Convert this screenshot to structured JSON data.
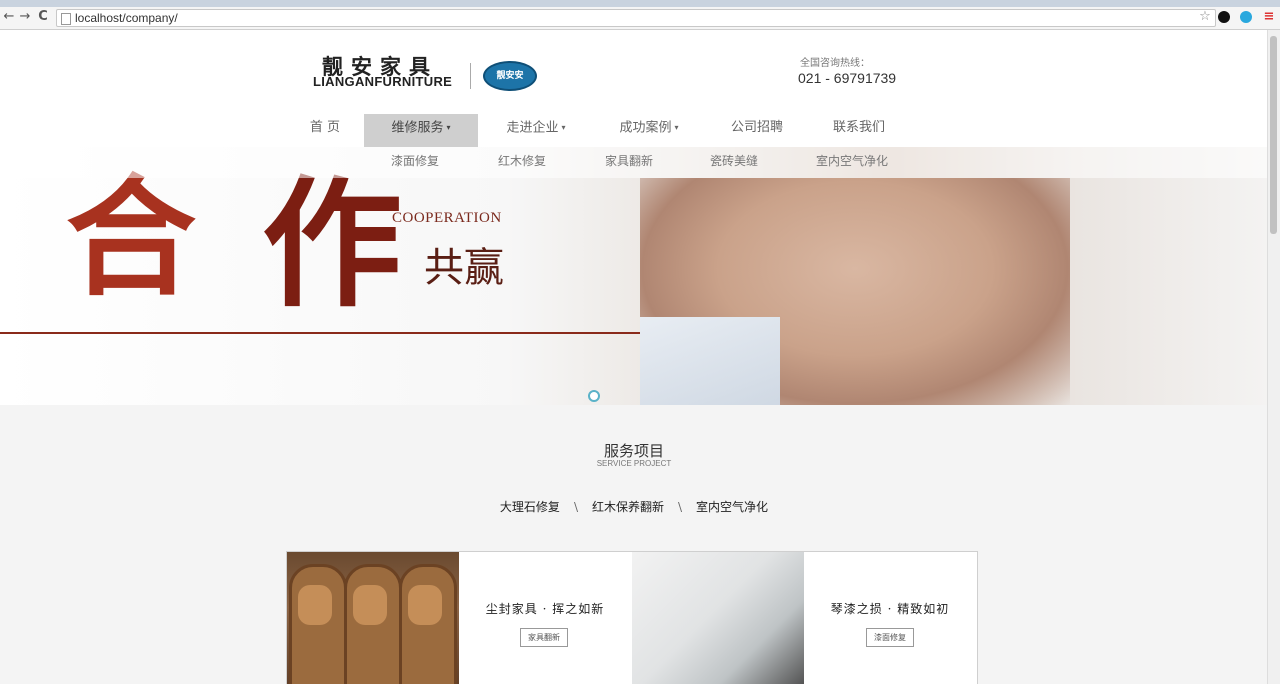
{
  "browser": {
    "back_glyph": "←",
    "forward_glyph": "→",
    "reload_glyph": "C",
    "url": "localhost/company/",
    "star_glyph": "☆",
    "menu_glyph": "≡"
  },
  "header": {
    "logo_cn": "靓安家具",
    "logo_en": "LIANGANFURNITURE",
    "badge_text": "靓安安",
    "hotline_label": "全国咨询热线：",
    "hotline_number": "021 - 69791739"
  },
  "nav": {
    "items": [
      {
        "label": "首 页"
      },
      {
        "label": "维修服务"
      },
      {
        "label": "走进企业"
      },
      {
        "label": "成功案例"
      },
      {
        "label": "公司招聘"
      },
      {
        "label": "联系我们"
      }
    ],
    "caret": "▾"
  },
  "subnav": {
    "items": [
      "漆面修复",
      "红木修复",
      "家具翻新",
      "瓷砖美缝",
      "室内空气净化"
    ]
  },
  "banner": {
    "char1": "合",
    "char2": "作",
    "english": "COOPERATION",
    "subtitle": "共赢"
  },
  "services": {
    "title_cn": "服务项目",
    "title_en": "SERVICE PROJECT",
    "tabs": [
      "大理石修复",
      "红木保养翻新",
      "室内空气净化"
    ],
    "separator": "\\"
  },
  "cards": [
    {
      "text": "尘封家具 · 挥之如新",
      "button": "家具翻新"
    },
    {
      "text": "琴漆之损 · 精致如初",
      "button": "漆面修复"
    }
  ],
  "colors": {
    "accent_red": "#9e2a1a",
    "nav_active": "#cfcfcf"
  }
}
